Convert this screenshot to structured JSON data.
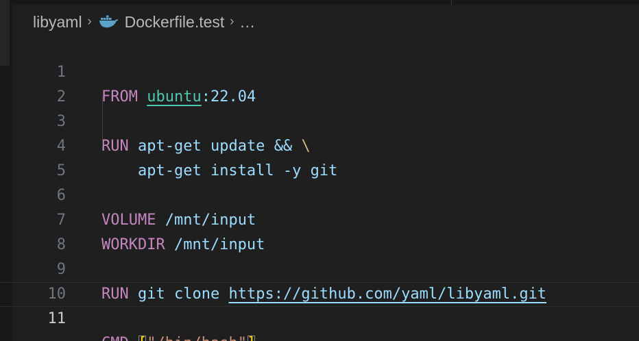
{
  "breadcrumb": {
    "folder": "libyaml",
    "file": "Dockerfile.test",
    "ellipsis": "…",
    "file_icon": "docker-whale-icon"
  },
  "editor": {
    "current_line": "11",
    "lines": [
      {
        "num": "1",
        "tokens": [
          "FROM",
          " ",
          "ubuntu",
          ":22.04"
        ]
      },
      {
        "num": "2",
        "tokens": []
      },
      {
        "num": "3",
        "tokens": [
          "RUN",
          " ",
          "apt-get update",
          " ",
          "&&",
          " ",
          "\\"
        ]
      },
      {
        "num": "4",
        "tokens": [
          "    ",
          "apt-get install -y git"
        ]
      },
      {
        "num": "5",
        "tokens": []
      },
      {
        "num": "6",
        "tokens": [
          "VOLUME",
          " ",
          "/mnt/input"
        ]
      },
      {
        "num": "7",
        "tokens": [
          "WORKDIR",
          " ",
          "/mnt/input"
        ]
      },
      {
        "num": "8",
        "tokens": []
      },
      {
        "num": "9",
        "tokens": [
          "RUN",
          " ",
          "git clone",
          " ",
          "https://github.com/yaml/libyaml.git"
        ]
      },
      {
        "num": "10",
        "tokens": []
      },
      {
        "num": "11",
        "tokens": [
          "CMD",
          " ",
          "[",
          "\"/bin/bash\"",
          "]"
        ]
      }
    ]
  },
  "colors": {
    "keyword": "#c586c0",
    "image": "#4ec9b0",
    "text": "#9cdcfe",
    "string": "#ce9178",
    "bracket": "#ffd700",
    "escape": "#d7ba7d"
  }
}
